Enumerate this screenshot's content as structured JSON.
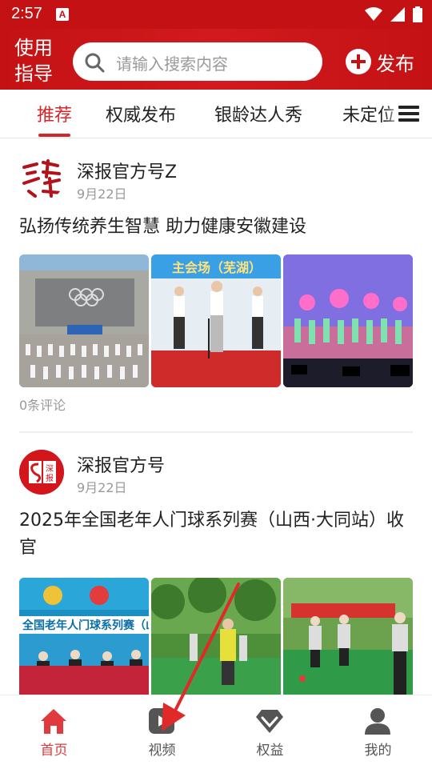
{
  "status_bar": {
    "time": "2:57",
    "notification_letter": "A",
    "icons": [
      "wifi-icon",
      "signal-icon",
      "battery-icon"
    ]
  },
  "header": {
    "use_guide_label": "使用指导",
    "search_placeholder": "请输入搜索内容",
    "publish_label": "发布"
  },
  "tabs": [
    {
      "label": "推荐",
      "active": true
    },
    {
      "label": "权威发布",
      "active": false
    },
    {
      "label": "银龄达人秀",
      "active": false
    },
    {
      "label": "未定位",
      "active": false
    }
  ],
  "posts": [
    {
      "account": "深报官方号Z",
      "date": "9月22日",
      "title": "弘扬传统养生智慧  助力健康安徽建设",
      "images": [
        {
          "caption": ""
        },
        {
          "caption": "主会场（芜湖）"
        },
        {
          "caption": ""
        }
      ],
      "comments": "0条评论"
    },
    {
      "account": "深报官方号",
      "date": "9月22日",
      "title": "2025年全国老年人门球系列赛（山西·大同站）收官",
      "images": [
        {
          "caption": "全国老年人门球系列赛（山"
        },
        {
          "caption": ""
        },
        {
          "caption": ""
        }
      ]
    }
  ],
  "bottom_nav": [
    {
      "label": "首页",
      "icon": "home-icon",
      "active": true
    },
    {
      "label": "视频",
      "icon": "video-icon",
      "active": false
    },
    {
      "label": "权益",
      "icon": "diamond-icon",
      "active": false
    },
    {
      "label": "我的",
      "icon": "profile-icon",
      "active": false
    }
  ],
  "colors": {
    "brand_red": "#c41214",
    "active_tab": "#d3262a",
    "nav_active": "#e03a3e"
  }
}
